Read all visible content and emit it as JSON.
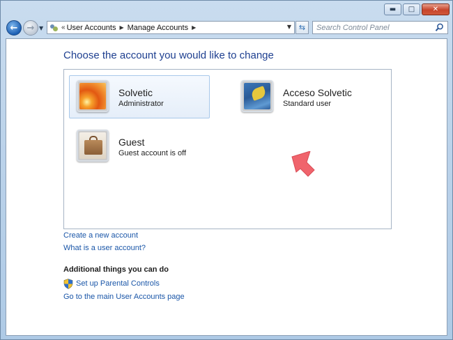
{
  "address": {
    "crumbs": [
      "User Accounts",
      "Manage Accounts"
    ],
    "overflow_chevron": "«"
  },
  "search": {
    "placeholder": "Search Control Panel"
  },
  "main": {
    "heading": "Choose the account you would like to change",
    "accounts": [
      {
        "name": "Solvetic",
        "type": "Administrator",
        "picture": "flower",
        "selected": true
      },
      {
        "name": "Acceso Solvetic",
        "type": "Standard user",
        "picture": "leaf",
        "selected": false
      },
      {
        "name": "Guest",
        "type": "Guest account is off",
        "picture": "briefcase",
        "selected": false
      }
    ],
    "links": {
      "create_account": "Create a new account",
      "what_is_account": "What is a user account?"
    },
    "additional": {
      "title": "Additional things you can do",
      "parental_controls": "Set up Parental Controls",
      "main_page": "Go to the main User Accounts page"
    }
  },
  "colors": {
    "heading": "#1e3f90",
    "link": "#1a56a8",
    "hint_arrow": "#f0646c"
  }
}
